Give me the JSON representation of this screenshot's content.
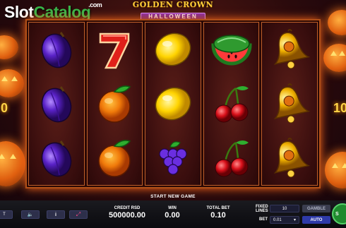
{
  "watermark": {
    "name_white": "Slot",
    "name_green": "Catalog",
    "suffix": ".com"
  },
  "game_logo": {
    "title": "GOLDEN CROWN",
    "subtitle": "HALLOWEEN"
  },
  "side_numbers": {
    "left": "0",
    "right": "10"
  },
  "reels": [
    [
      "plum",
      "plum",
      "plum"
    ],
    [
      "seven",
      "orange",
      "orange"
    ],
    [
      "lemon",
      "lemon",
      "grapes"
    ],
    [
      "watermelon",
      "cherries",
      "cherries"
    ],
    [
      "bell",
      "bell",
      "bell"
    ]
  ],
  "message": "START NEW GAME",
  "controls": {
    "left_partial_label": "T",
    "sound_icon": "speaker-icon",
    "info_icon": "info-icon",
    "fullscreen_icon": "fullscreen-icon"
  },
  "stats": {
    "credit_label": "CREDIT RSD",
    "credit_value": "500000.00",
    "win_label": "WIN",
    "win_value": "0.00",
    "total_bet_label": "TOTAL BET",
    "total_bet_value": "0.10"
  },
  "settings": {
    "fixed_lines_label_1": "FIXED",
    "fixed_lines_label_2": "LINES",
    "fixed_lines_value": "10",
    "bet_label": "BET",
    "bet_value": "0.01",
    "bet_arrow": "▾",
    "gamble_label": "GAMBLE",
    "auto_label": "AUTO",
    "spin_partial": "S"
  },
  "colors": {
    "reel_border": "#c0602a",
    "logo_gold": "#ffcf3a",
    "watermark_green": "#39b54a",
    "auto_button": "#2e3aa8",
    "spin_button": "#1f8a2e"
  }
}
